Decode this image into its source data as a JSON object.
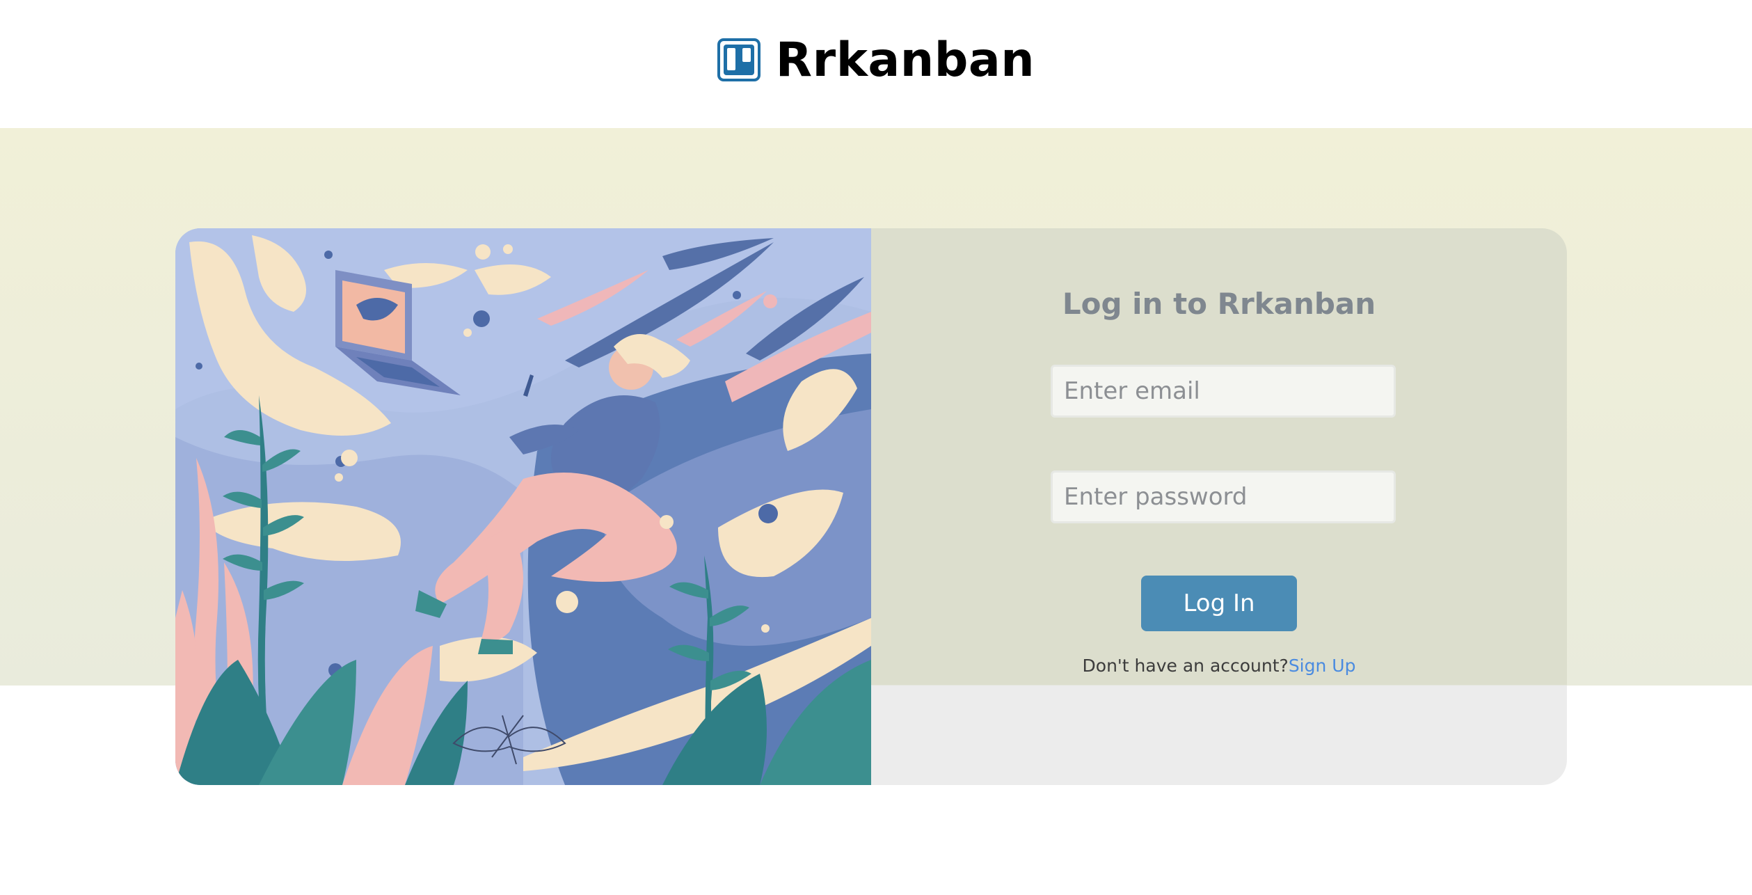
{
  "brand": {
    "name": "Rrkanban",
    "logo_icon": "kanban-board-icon",
    "logo_color": "#1e6fa7"
  },
  "login": {
    "title": "Log in to Rrkanban",
    "email_placeholder": "Enter email",
    "password_placeholder": "Enter password",
    "submit_label": "Log In",
    "signup_prompt": "Don't have an account?",
    "signup_link": "Sign Up"
  },
  "colors": {
    "accent_button": "#4b8cb5",
    "link": "#4a8be0",
    "band_background": "#f1f0d8",
    "illustration_background": "#aebfe4"
  }
}
